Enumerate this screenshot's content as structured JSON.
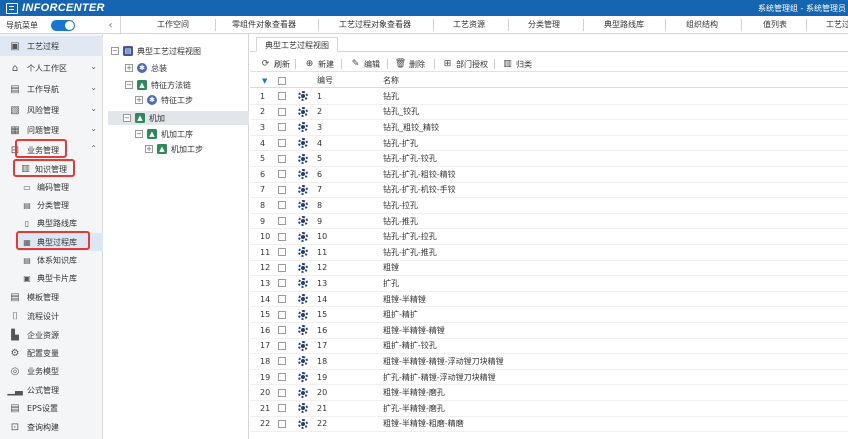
{
  "app": {
    "logo_text": "INFORCENTER",
    "user_text": "系统管理组 - 系统管理员"
  },
  "nav": {
    "label": "导航菜单",
    "menu": [
      "工作空间",
      "零组件对象查看器",
      "工艺过程对象查看器",
      "工艺资源",
      "分类管理",
      "典型路线库",
      "组织结构",
      "值列表",
      "工艺过"
    ]
  },
  "sidebar": {
    "top_items": [
      {
        "label": "工艺过程",
        "icon": "process-icon"
      },
      {
        "label": "个人工作区",
        "icon": "home-icon"
      },
      {
        "label": "工作导航",
        "icon": "briefcase-icon"
      },
      {
        "label": "风险管理",
        "icon": "risk-icon"
      },
      {
        "label": "问题管理",
        "icon": "issue-icon"
      },
      {
        "label": "业务管理",
        "icon": "business-icon"
      }
    ],
    "knowledge": "知识管理",
    "knowledge_children": [
      "编码管理",
      "分类管理",
      "典型路线库",
      "典型过程库",
      "体系知识库",
      "典型卡片库"
    ],
    "bottom_items": [
      {
        "label": "模板管理",
        "icon": "template-icon"
      },
      {
        "label": "流程设计",
        "icon": "flow-icon"
      },
      {
        "label": "企业资源",
        "icon": "resource-icon"
      },
      {
        "label": "配置变量",
        "icon": "config-icon"
      },
      {
        "label": "业务模型",
        "icon": "model-icon"
      },
      {
        "label": "公式管理",
        "icon": "chart-icon"
      },
      {
        "label": "EPS设置",
        "icon": "eps-icon"
      },
      {
        "label": "查询构建",
        "icon": "query-icon"
      }
    ]
  },
  "tree": {
    "root": "典型工艺过程视图",
    "nodes": [
      "总装",
      "特征方法链",
      "特征工步",
      "机加",
      "机加工序",
      "机加工步"
    ]
  },
  "main": {
    "tab": "典型工艺过程视图",
    "toolbar": [
      "刷新",
      "新建",
      "编辑",
      "删除",
      "部门授权",
      "归类"
    ],
    "col_number": "编号",
    "col_name": "名称",
    "rows": [
      {
        "idx": "1",
        "num": "1",
        "name": "钻孔"
      },
      {
        "idx": "2",
        "num": "2",
        "name": "钻孔_铰孔"
      },
      {
        "idx": "3",
        "num": "3",
        "name": "钻孔_粗铰_精铰"
      },
      {
        "idx": "4",
        "num": "4",
        "name": "钻孔-扩孔"
      },
      {
        "idx": "5",
        "num": "5",
        "name": "钻孔-扩孔-铰孔"
      },
      {
        "idx": "6",
        "num": "6",
        "name": "钻孔-扩孔-粗铰-精铰"
      },
      {
        "idx": "7",
        "num": "7",
        "name": "钻孔-扩孔-机铰-手铰"
      },
      {
        "idx": "8",
        "num": "8",
        "name": "钻孔-拉孔"
      },
      {
        "idx": "9",
        "num": "9",
        "name": "钻孔-推孔"
      },
      {
        "idx": "10",
        "num": "10",
        "name": "钻孔-扩孔-拉孔"
      },
      {
        "idx": "11",
        "num": "11",
        "name": "钻孔-扩孔-推孔"
      },
      {
        "idx": "12",
        "num": "12",
        "name": "粗镗"
      },
      {
        "idx": "13",
        "num": "13",
        "name": "扩孔"
      },
      {
        "idx": "14",
        "num": "14",
        "name": "粗镗-半精镗"
      },
      {
        "idx": "15",
        "num": "15",
        "name": "粗扩-精扩"
      },
      {
        "idx": "16",
        "num": "16",
        "name": "粗镗-半精镗-精镗"
      },
      {
        "idx": "17",
        "num": "17",
        "name": "粗扩-精扩-铰孔"
      },
      {
        "idx": "18",
        "num": "18",
        "name": "粗镗-半精镗-精镗-浮动镗刀块精镗"
      },
      {
        "idx": "19",
        "num": "19",
        "name": "扩孔-精扩-精镗-浮动镗刀块精镗"
      },
      {
        "idx": "20",
        "num": "20",
        "name": "粗镗-半精镗-磨孔"
      },
      {
        "idx": "21",
        "num": "21",
        "name": "扩孔-半精镗-磨孔"
      },
      {
        "idx": "22",
        "num": "22",
        "name": "粗镗-半精镗-粗磨-精磨"
      }
    ]
  },
  "colors": {
    "header": "#1565b0",
    "accent": "#1976d2",
    "highlight_box": "#e53935"
  }
}
